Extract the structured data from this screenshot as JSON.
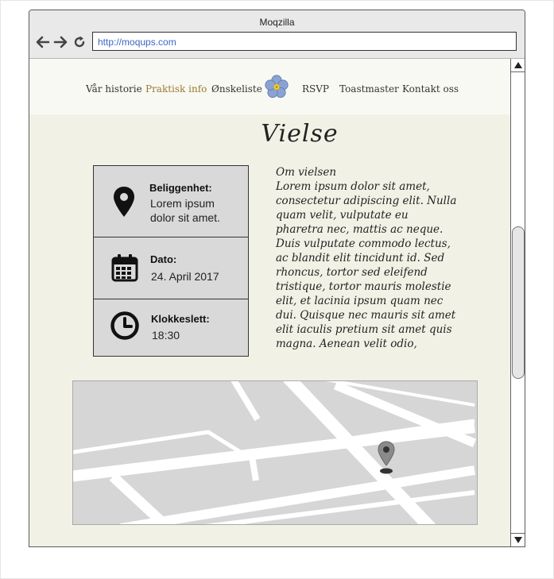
{
  "browser": {
    "title": "Moqzilla",
    "url": "http://moqups.com",
    "back_icon": "arrow-left-icon",
    "forward_icon": "arrow-right-icon",
    "reload_icon": "reload-icon"
  },
  "nav": {
    "items": [
      {
        "label": "Vår historie"
      },
      {
        "label": "Praktisk info",
        "active": true
      },
      {
        "label": "Ønskeliste"
      },
      {
        "label": "RSVP"
      },
      {
        "label": "Toastmaster"
      },
      {
        "label": "Kontakt oss"
      }
    ],
    "logo_icon": "flower-icon",
    "active_color": "#9a7a30"
  },
  "page": {
    "heading": "Vielse"
  },
  "details": [
    {
      "label": "Beliggenhet:",
      "value": "Lorem ipsum dolor sit amet.",
      "icon": "map-pin-icon"
    },
    {
      "label": "Dato:",
      "value": "24. April 2017",
      "icon": "calendar-icon"
    },
    {
      "label": "Klokkeslett:",
      "value": "18:30",
      "icon": "clock-icon"
    }
  ],
  "about": {
    "title": "Om vielsen",
    "body": "Lorem ipsum dolor sit amet, consectetur adipiscing elit. Nulla quam velit, vulputate eu pharetra nec, mattis ac neque. Duis vulputate commodo lectus, ac blandit elit tincidunt id. Sed rhoncus, tortor sed eleifend tristique, tortor mauris molestie elit, et lacinia ipsum quam nec dui. Quisque nec mauris sit amet elit iaculis pretium sit amet quis magna. Aenean velit odio,"
  },
  "map": {
    "marker_icon": "map-marker-icon"
  },
  "colors": {
    "page_background": "#f2f1e6",
    "header_background": "#f9f9f4",
    "info_box_background": "#d9d9d9",
    "url_text": "#3b66c4"
  }
}
